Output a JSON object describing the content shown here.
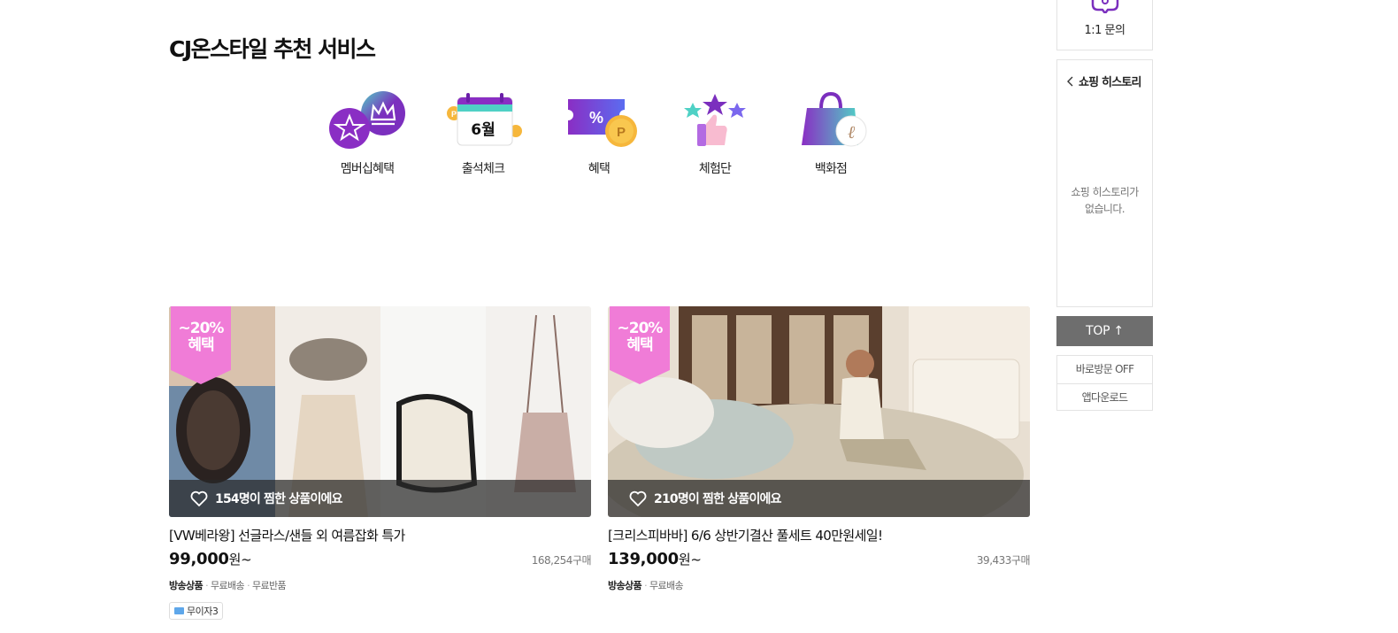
{
  "section_title": "CJ온스타일 추천 서비스",
  "services": [
    {
      "label": "멤버십혜택",
      "icon": "membership-crown-icon"
    },
    {
      "label": "출석체크",
      "icon": "calendar-icon",
      "calendar_text": "6월"
    },
    {
      "label": "혜택",
      "icon": "coupon-icon"
    },
    {
      "label": "체험단",
      "icon": "thumbs-up-stars-icon"
    },
    {
      "label": "백화점",
      "icon": "shopping-bag-icon"
    }
  ],
  "products": [
    {
      "badge": {
        "line1": "~20%",
        "line2": "혜택"
      },
      "wish_text": "154명이 찜한 상품이에요",
      "name": "[VW베라왕] 선글라스/샌들 외 여름잡화 특가",
      "price": "99,000",
      "price_unit": "원~",
      "buy_count": "168,254구매",
      "tags": [
        "방송상품",
        "무료배송",
        "무료반품"
      ],
      "chip": "무이자3"
    },
    {
      "badge": {
        "line1": "~20%",
        "line2": "혜택"
      },
      "wish_text": "210명이 찜한 상품이에요",
      "name": "[크리스피바바] 6/6 상반기결산 풀세트 40만원세일!",
      "price": "139,000",
      "price_unit": "원~",
      "buy_count": "39,433구매",
      "tags": [
        "방송상품",
        "무료배송"
      ]
    }
  ],
  "sidebar": {
    "inquiry_label": "1:1 문의",
    "history_title": "쇼핑 히스토리",
    "history_empty_line1": "쇼핑 히스토리가",
    "history_empty_line2": "없습니다.",
    "top_label": "TOP ↑",
    "link_direct_off": "바로방문 OFF",
    "link_app_download": "앱다운로드"
  },
  "colors": {
    "purple": "#7b2fbe",
    "badge_pink": "#f07cd7",
    "top_button": "#6e6e6e"
  }
}
